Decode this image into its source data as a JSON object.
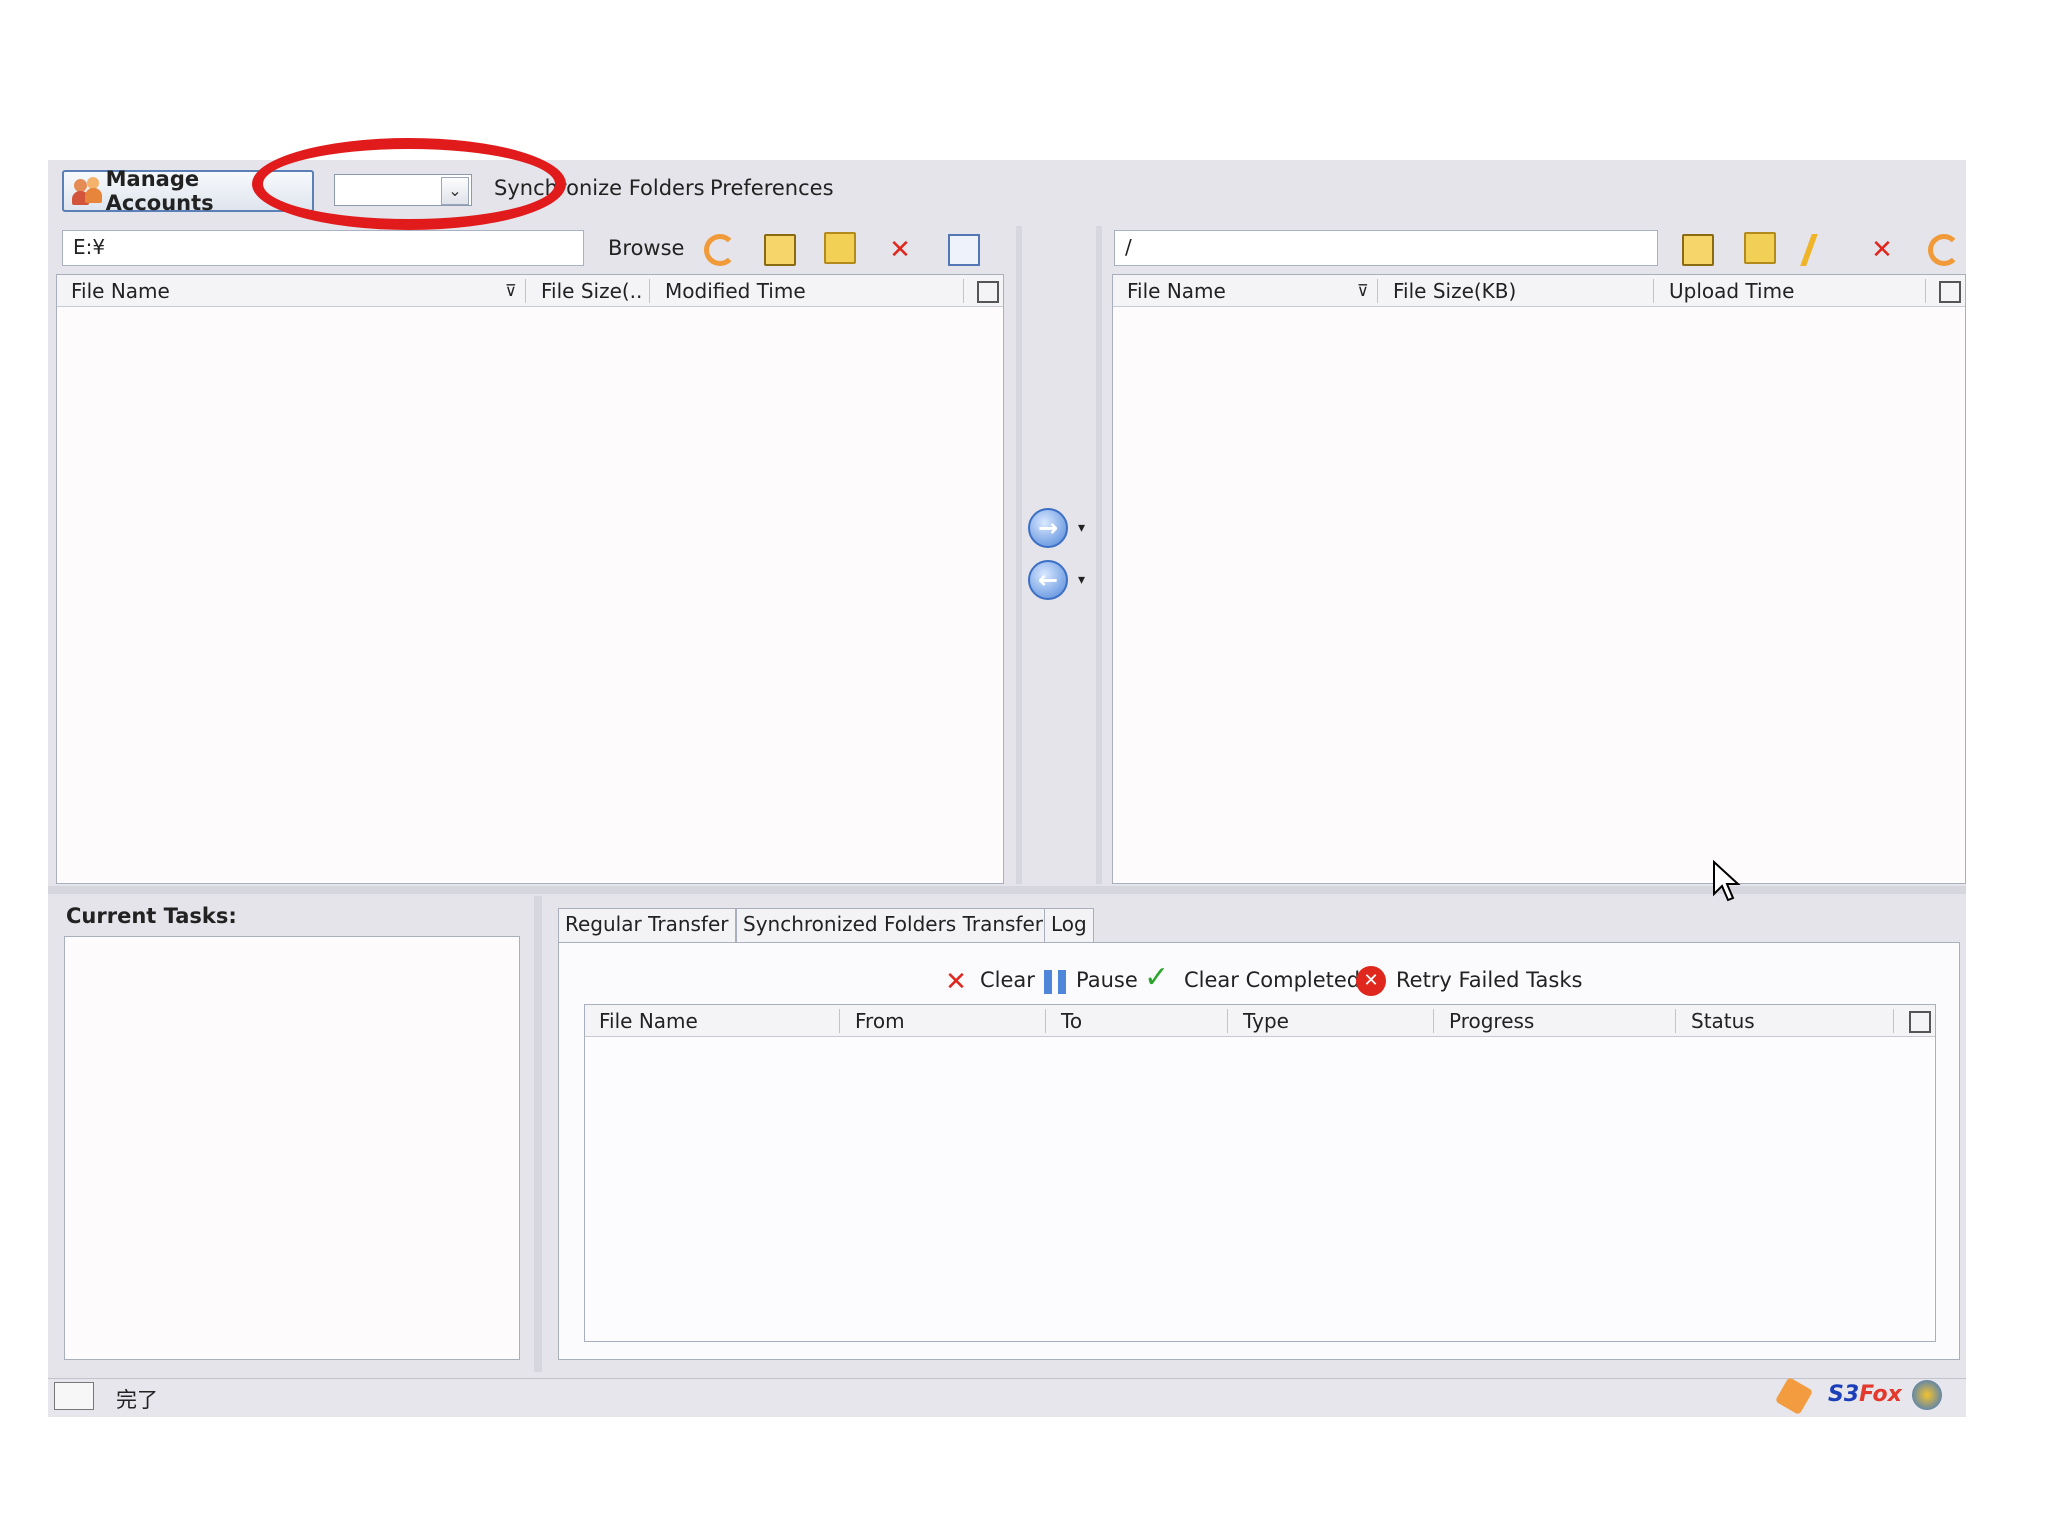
{
  "toolbar": {
    "manage_accounts": "Manage Accounts",
    "account_select_value": "",
    "synchronize_folders": "Synchronize Folders",
    "preferences": "Preferences"
  },
  "local": {
    "path": "E:¥",
    "browse": "Browse",
    "columns": [
      "File Name",
      "File Size(..",
      "Modified Time"
    ]
  },
  "remote": {
    "path": "/",
    "columns": [
      "File Name",
      "File Size(KB)",
      "Upload Time"
    ]
  },
  "tasks": {
    "current_tasks_label": "Current Tasks:",
    "tabs": [
      "Regular Transfer",
      "Synchronized Folders Transfer",
      "Log"
    ],
    "actions": {
      "clear": "Clear",
      "pause": "Pause",
      "clear_completed": "Clear Completed",
      "retry_failed": "Retry Failed Tasks"
    },
    "columns": [
      "File Name",
      "From",
      "To",
      "Type",
      "Progress",
      "Status"
    ]
  },
  "statusbar": {
    "text": "完了",
    "brand_prefix": "S3",
    "brand_suffix": "Fox"
  },
  "colors": {
    "highlight": "#e11b1b",
    "window_bg": "#e4e4ea"
  },
  "icons": [
    "people-icon",
    "refresh-icon",
    "folder-up-icon",
    "new-folder-icon",
    "delete-icon",
    "view-icon",
    "rename-icon",
    "upload-arrow-icon",
    "download-arrow-icon",
    "column-picker-icon",
    "clear-icon",
    "pause-icon",
    "checkmark-icon",
    "retry-icon",
    "s3fox-logo",
    "mouse-cursor-icon"
  ]
}
